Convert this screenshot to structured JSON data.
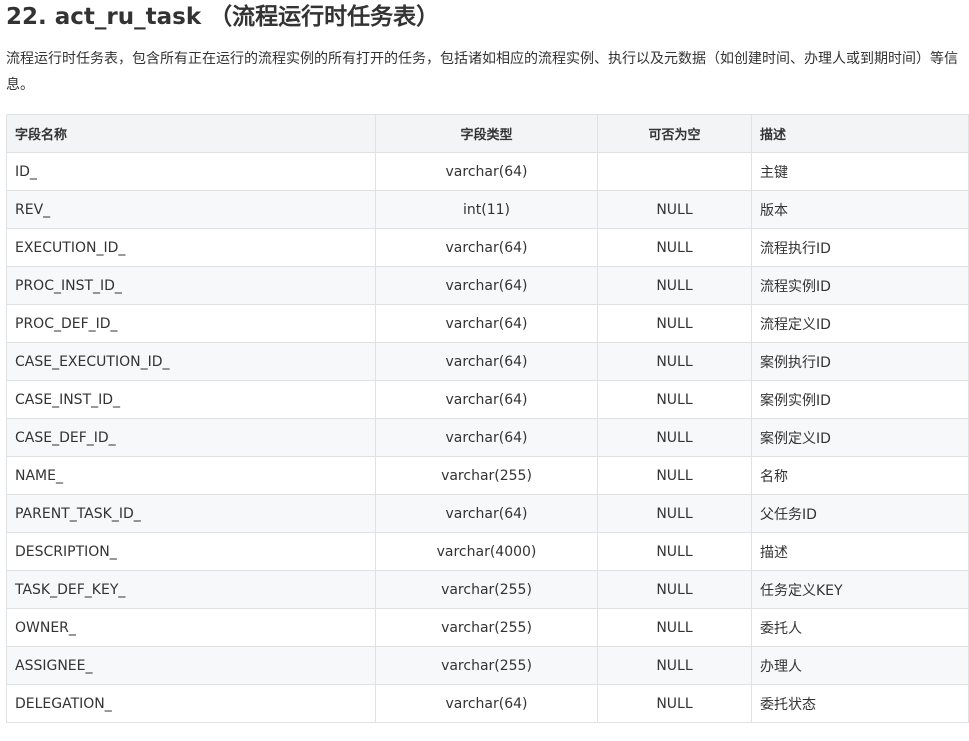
{
  "section": {
    "title": "22. act_ru_task （流程运行时任务表）",
    "description": "流程运行时任务表，包含所有正在运行的流程实例的所有打开的任务，包括诸如相应的流程实例、执行以及元数据（如创建时间、办理人或到期时间）等信息。"
  },
  "table": {
    "headers": {
      "name": "字段名称",
      "type": "字段类型",
      "nullable": "可否为空",
      "desc": "描述"
    },
    "rows": [
      {
        "name": "ID_",
        "type": "varchar(64)",
        "nullable": "",
        "desc": "主键"
      },
      {
        "name": "REV_",
        "type": "int(11)",
        "nullable": "NULL",
        "desc": "版本"
      },
      {
        "name": "EXECUTION_ID_",
        "type": "varchar(64)",
        "nullable": "NULL",
        "desc": "流程执行ID"
      },
      {
        "name": "PROC_INST_ID_",
        "type": "varchar(64)",
        "nullable": "NULL",
        "desc": "流程实例ID"
      },
      {
        "name": "PROC_DEF_ID_",
        "type": "varchar(64)",
        "nullable": "NULL",
        "desc": "流程定义ID"
      },
      {
        "name": "CASE_EXECUTION_ID_",
        "type": "varchar(64)",
        "nullable": "NULL",
        "desc": "案例执行ID"
      },
      {
        "name": "CASE_INST_ID_",
        "type": "varchar(64)",
        "nullable": "NULL",
        "desc": "案例实例ID"
      },
      {
        "name": "CASE_DEF_ID_",
        "type": "varchar(64)",
        "nullable": "NULL",
        "desc": "案例定义ID"
      },
      {
        "name": "NAME_",
        "type": "varchar(255)",
        "nullable": "NULL",
        "desc": "名称"
      },
      {
        "name": "PARENT_TASK_ID_",
        "type": "varchar(64)",
        "nullable": "NULL",
        "desc": "父任务ID"
      },
      {
        "name": "DESCRIPTION_",
        "type": "varchar(4000)",
        "nullable": "NULL",
        "desc": "描述"
      },
      {
        "name": "TASK_DEF_KEY_",
        "type": "varchar(255)",
        "nullable": "NULL",
        "desc": "任务定义KEY"
      },
      {
        "name": "OWNER_",
        "type": "varchar(255)",
        "nullable": "NULL",
        "desc": "委托人"
      },
      {
        "name": "ASSIGNEE_",
        "type": "varchar(255)",
        "nullable": "NULL",
        "desc": "办理人"
      },
      {
        "name": "DELEGATION_",
        "type": "varchar(64)",
        "nullable": "NULL",
        "desc": "委托状态"
      }
    ]
  }
}
